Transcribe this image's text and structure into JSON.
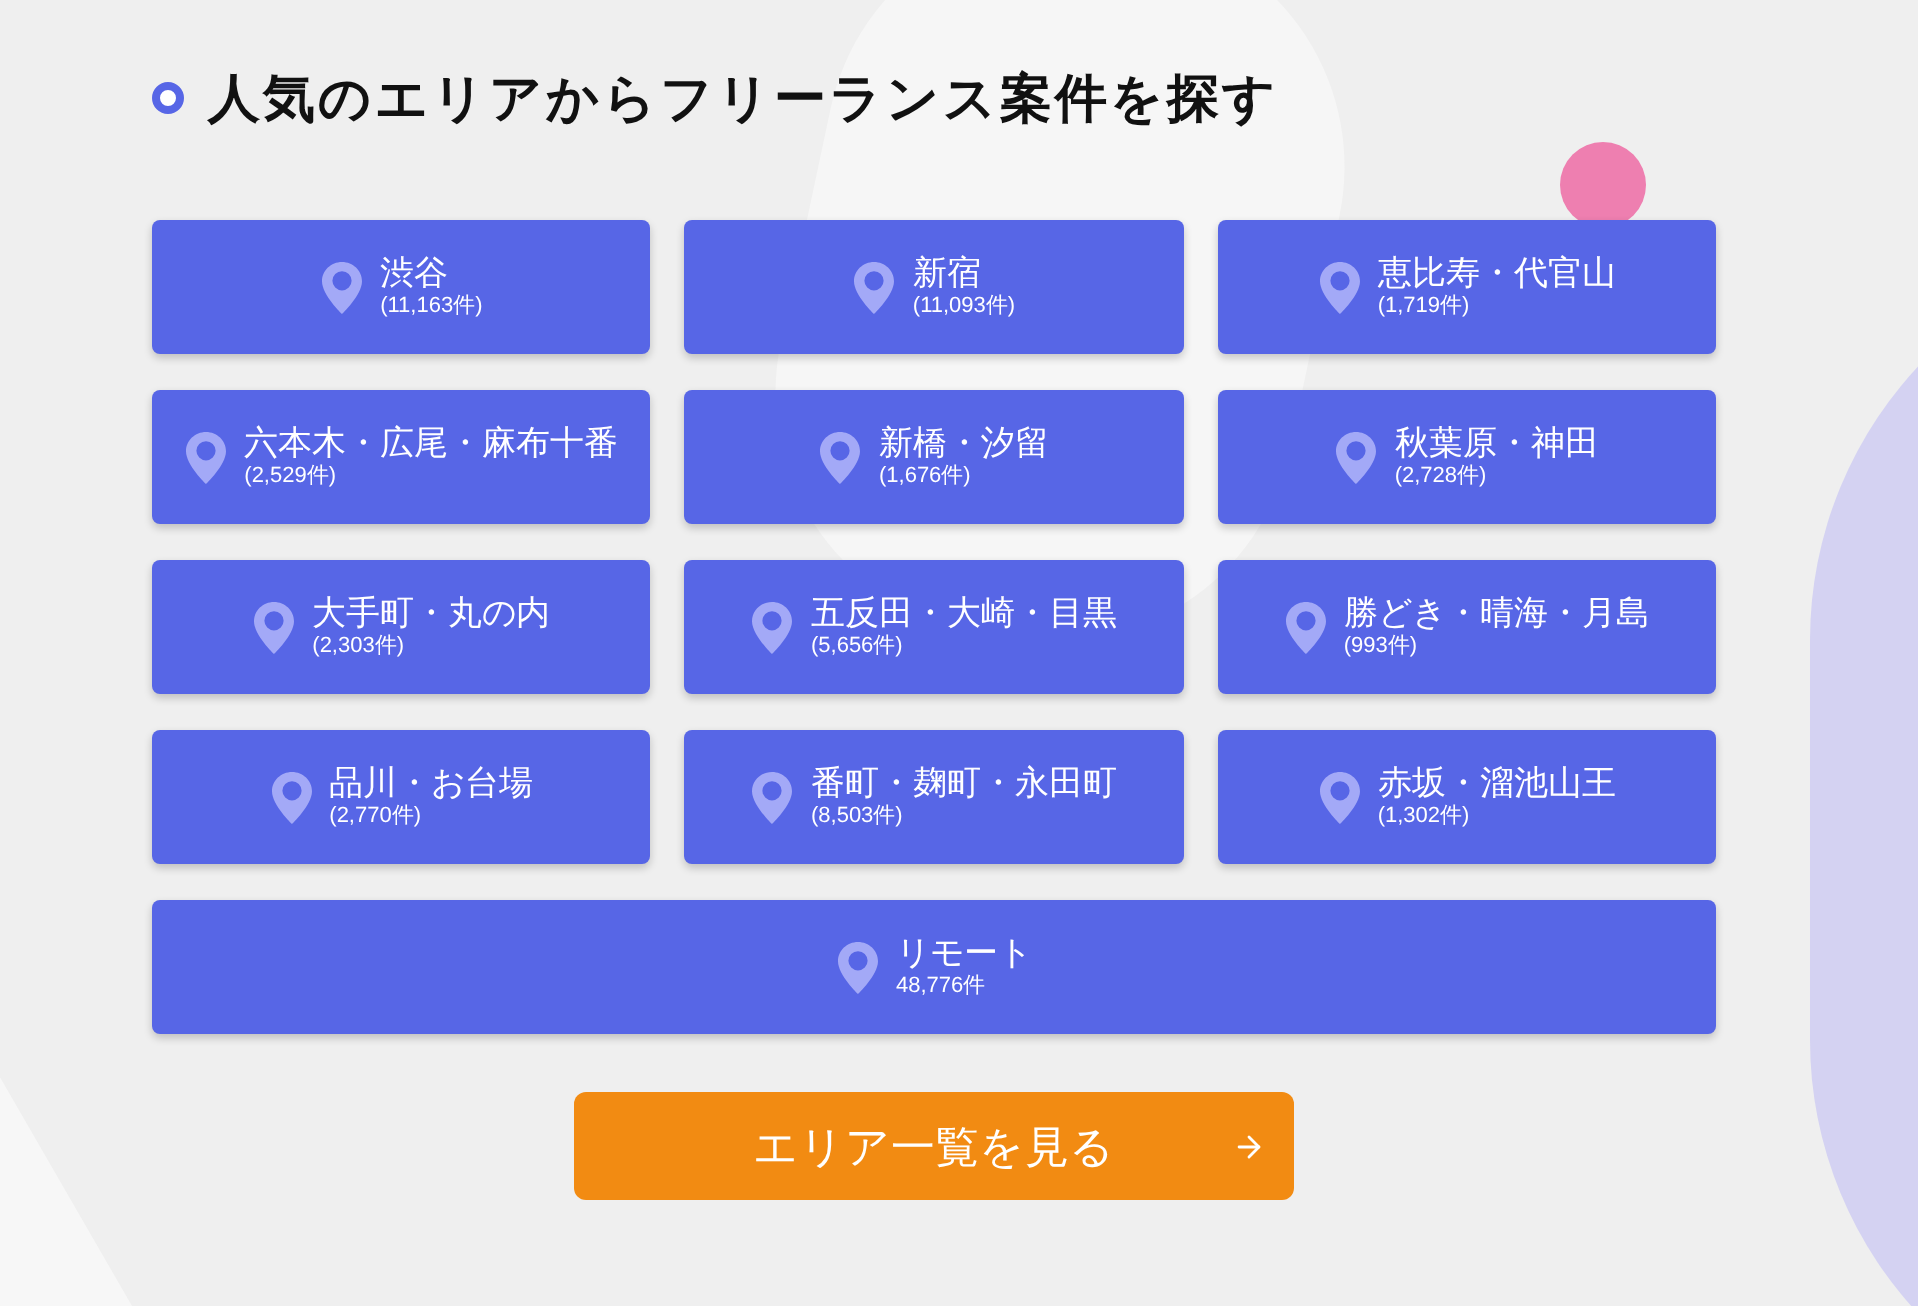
{
  "heading": "人気のエリアからフリーランス案件を探す",
  "areas": [
    {
      "name": "渋谷",
      "count": "(11,163件)",
      "kind": "normal"
    },
    {
      "name": "新宿",
      "count": "(11,093件)",
      "kind": "normal"
    },
    {
      "name": "恵比寿・代官山",
      "count": "(1,719件)",
      "kind": "normal"
    },
    {
      "name": "六本木・広尾・麻布十番",
      "count": "(2,529件)",
      "kind": "normal"
    },
    {
      "name": "新橋・汐留",
      "count": "(1,676件)",
      "kind": "normal"
    },
    {
      "name": "秋葉原・神田",
      "count": "(2,728件)",
      "kind": "normal"
    },
    {
      "name": "大手町・丸の内",
      "count": "(2,303件)",
      "kind": "normal"
    },
    {
      "name": "五反田・大崎・目黒",
      "count": "(5,656件)",
      "kind": "normal"
    },
    {
      "name": "勝どき・晴海・月島",
      "count": "(993件)",
      "kind": "normal"
    },
    {
      "name": "品川・お台場",
      "count": "(2,770件)",
      "kind": "normal"
    },
    {
      "name": "番町・麹町・永田町",
      "count": "(8,503件)",
      "kind": "normal"
    },
    {
      "name": "赤坂・溜池山王",
      "count": "(1,302件)",
      "kind": "normal"
    },
    {
      "name": "リモート",
      "count": "48,776件",
      "kind": "wide"
    }
  ],
  "more_button": {
    "label": "エリア一覧を見る"
  }
}
